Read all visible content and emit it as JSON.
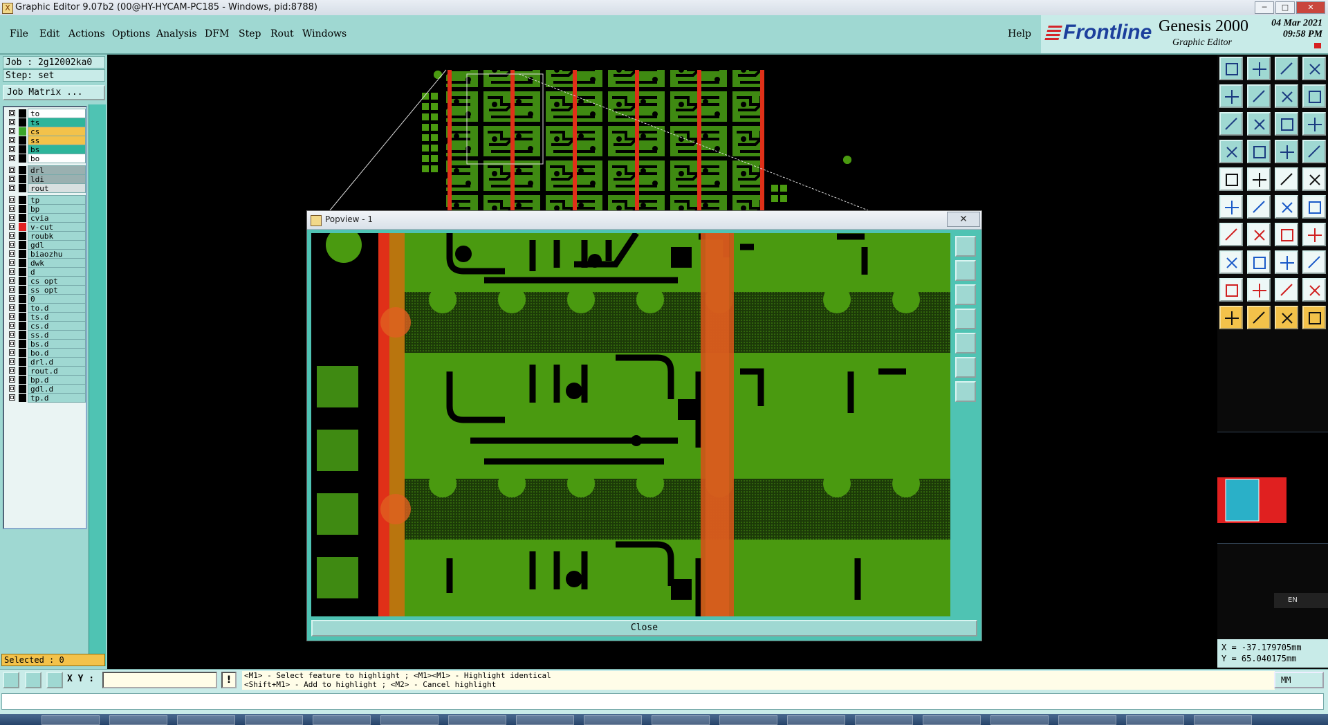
{
  "window": {
    "title": "Graphic Editor 9.07b2 (00@HY-HYCAM-PC185 - Windows, pid:8788)",
    "controls": [
      "─",
      "□",
      "✕"
    ]
  },
  "menu": {
    "items": [
      "File",
      "Edit",
      "Actions",
      "Options",
      "Analysis",
      "DFM",
      "Step",
      "Rout",
      "Windows"
    ],
    "help": "Help"
  },
  "brand": {
    "logo": "Frontline",
    "product": "Genesis 2000",
    "subtitle": "Graphic Editor",
    "date": "04 Mar 2021",
    "time": "09:58 PM"
  },
  "left_panel": {
    "job": "Job : 2g12002ka0",
    "step": "Step: set",
    "job_matrix_button": "Job Matrix ...",
    "layers": [
      {
        "name": "to",
        "color": "#ffffff",
        "swatch": "#000000",
        "group": 1
      },
      {
        "name": "ts",
        "color": "#2eb59b",
        "swatch": "#000000",
        "group": 1
      },
      {
        "name": "cs",
        "color": "#f3c24a",
        "swatch": "#3aa62a",
        "group": 1
      },
      {
        "name": "ss",
        "color": "#f3c24a",
        "swatch": "#000000",
        "group": 1
      },
      {
        "name": "bs",
        "color": "#2eb59b",
        "swatch": "#000000",
        "group": 1
      },
      {
        "name": "bo",
        "color": "#ffffff",
        "swatch": "#000000",
        "group": 1
      },
      {
        "name": "drl",
        "color": "#9ab0b0",
        "swatch": "#000000",
        "group": 2
      },
      {
        "name": "ldi",
        "color": "#9ab0b0",
        "swatch": "#000000",
        "group": 2
      },
      {
        "name": "rout",
        "color": "#d8e0e0",
        "swatch": "#000000",
        "group": 2
      },
      {
        "name": "tp",
        "color": "#9fd8d2",
        "swatch": "#000000",
        "group": 3
      },
      {
        "name": "bp",
        "color": "#9fd8d2",
        "swatch": "#000000",
        "group": 3
      },
      {
        "name": "cvia",
        "color": "#9fd8d2",
        "swatch": "#000000",
        "group": 3
      },
      {
        "name": "v-cut",
        "color": "#9fd8d2",
        "swatch": "#e02020",
        "group": 3,
        "active": true
      },
      {
        "name": "roubk",
        "color": "#9fd8d2",
        "swatch": "#000000",
        "group": 3
      },
      {
        "name": "gdl",
        "color": "#9fd8d2",
        "swatch": "#000000",
        "group": 3
      },
      {
        "name": "biaozhu",
        "color": "#9fd8d2",
        "swatch": "#000000",
        "group": 3
      },
      {
        "name": "dwk",
        "color": "#9fd8d2",
        "swatch": "#000000",
        "group": 3
      },
      {
        "name": "d",
        "color": "#9fd8d2",
        "swatch": "#000000",
        "group": 3
      },
      {
        "name": "cs_opt",
        "color": "#9fd8d2",
        "swatch": "#000000",
        "group": 3
      },
      {
        "name": "ss_opt",
        "color": "#9fd8d2",
        "swatch": "#000000",
        "group": 3
      },
      {
        "name": "0",
        "color": "#9fd8d2",
        "swatch": "#000000",
        "group": 3
      },
      {
        "name": "to.d",
        "color": "#9fd8d2",
        "swatch": "#000000",
        "group": 3
      },
      {
        "name": "ts.d",
        "color": "#9fd8d2",
        "swatch": "#000000",
        "group": 3
      },
      {
        "name": "cs.d",
        "color": "#9fd8d2",
        "swatch": "#000000",
        "group": 3
      },
      {
        "name": "ss.d",
        "color": "#9fd8d2",
        "swatch": "#000000",
        "group": 3
      },
      {
        "name": "bs.d",
        "color": "#9fd8d2",
        "swatch": "#000000",
        "group": 3
      },
      {
        "name": "bo.d",
        "color": "#9fd8d2",
        "swatch": "#000000",
        "group": 3
      },
      {
        "name": "drl.d",
        "color": "#9fd8d2",
        "swatch": "#000000",
        "group": 3
      },
      {
        "name": "rout.d",
        "color": "#9fd8d2",
        "swatch": "#000000",
        "group": 3
      },
      {
        "name": "bp.d",
        "color": "#9fd8d2",
        "swatch": "#000000",
        "group": 3
      },
      {
        "name": "gdl.d",
        "color": "#9fd8d2",
        "swatch": "#000000",
        "group": 3
      },
      {
        "name": "tp.d",
        "color": "#9fd8d2",
        "swatch": "#000000",
        "group": 3
      }
    ],
    "selected": "Selected : 0"
  },
  "popview": {
    "title": "Popview - 1",
    "close_x": "✕",
    "close_button": "Close"
  },
  "right_panel": {
    "coords_x": "X = -37.179705mm",
    "coords_y": "Y = 65.040175mm",
    "lang": "EN"
  },
  "status": {
    "xy_label": "X Y :",
    "xy_value": "",
    "hint_line1": "<M1> - Select feature to highlight ; <M1><M1> - Highlight identical",
    "hint_line2": "<Shift+M1> - Add to highlight ; <M2> - Cancel highlight",
    "units": "MM",
    "command": ""
  },
  "colors": {
    "panel": "#9fd8d2",
    "panel_light": "#c8ebe8",
    "copper": "#4a9a10",
    "vcut": "#e03018",
    "accent_yellow": "#f3c24a"
  }
}
